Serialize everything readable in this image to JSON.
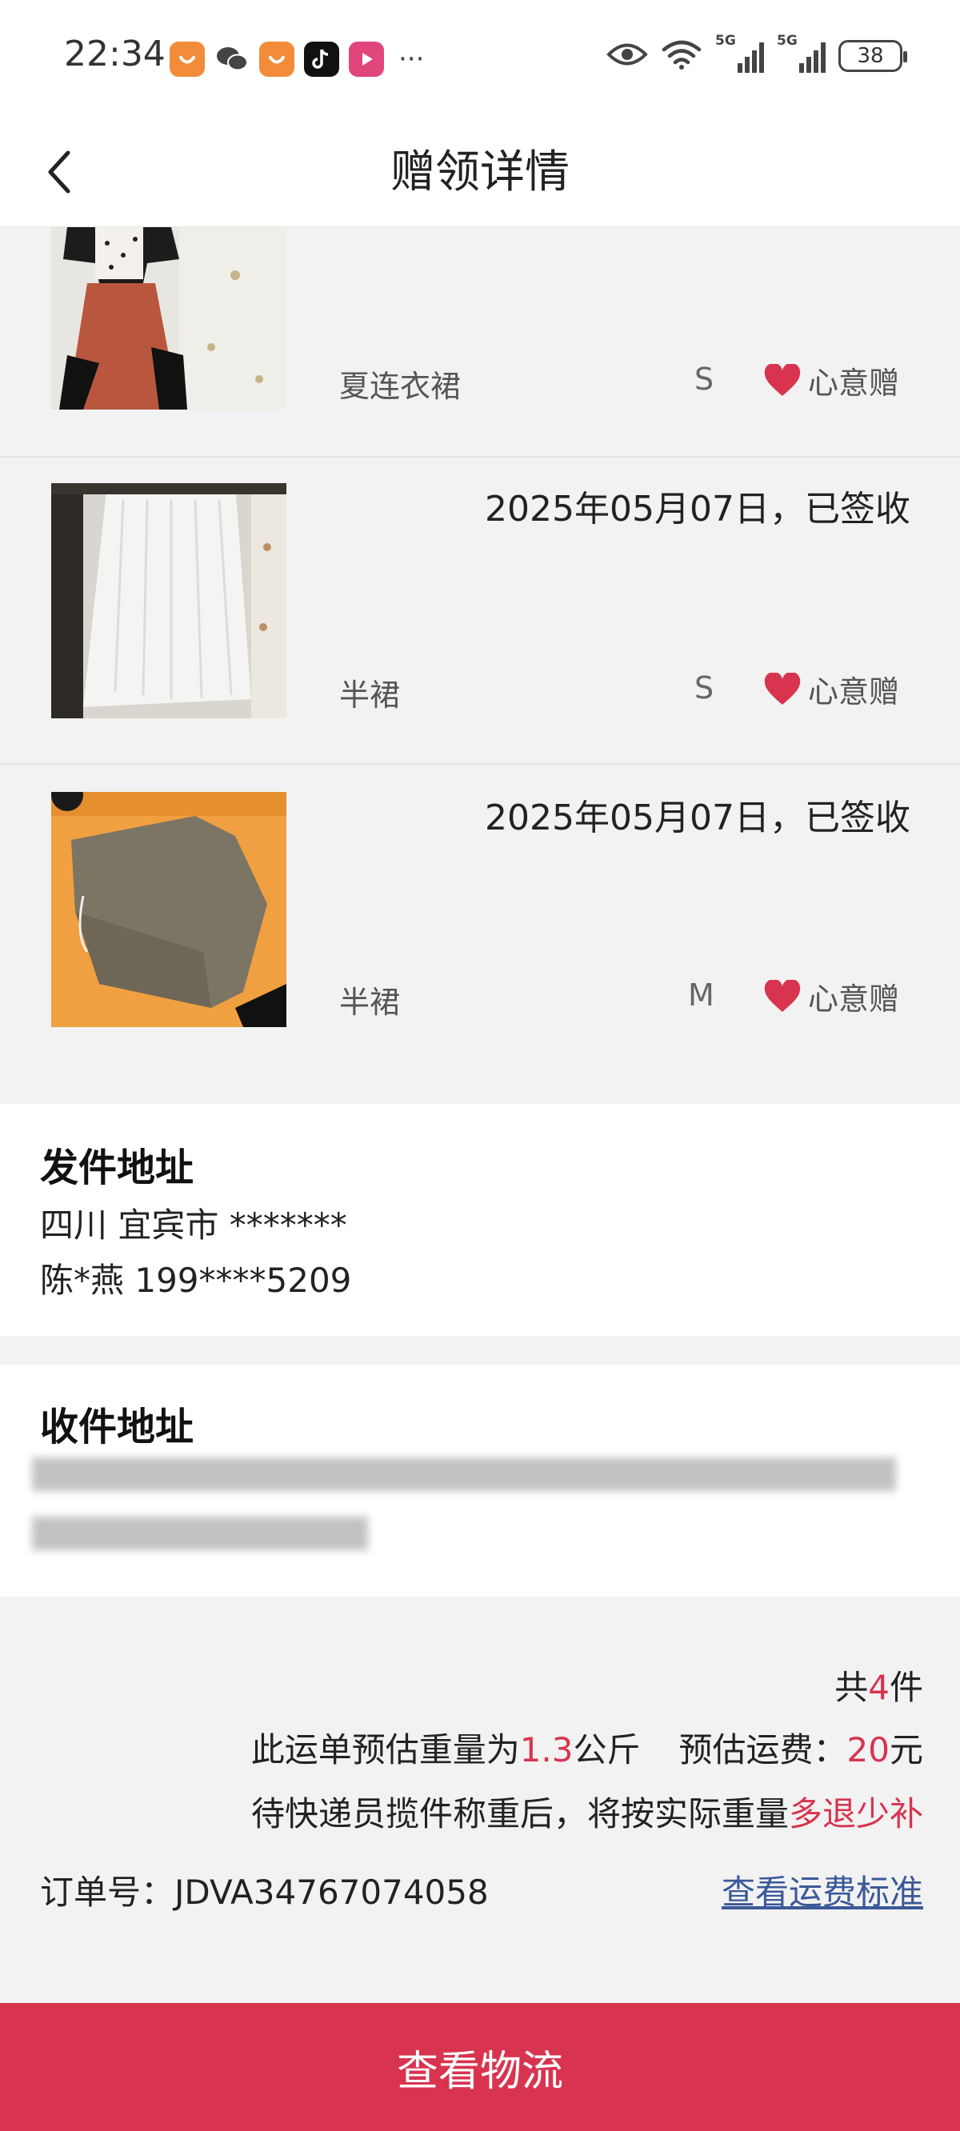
{
  "status_bar": {
    "time": "22:34",
    "apps": [
      "taobao-icon",
      "wechat-icon",
      "taobao-icon",
      "tiktok-icon",
      "video-icon"
    ],
    "more": "···",
    "signal1_label": "5G",
    "signal2_label": "5G",
    "battery": "38"
  },
  "header": {
    "title": "赠领详情"
  },
  "items": [
    {
      "date": "",
      "name": "夏连衣裙",
      "size": "S",
      "tag": "心意赠"
    },
    {
      "date": "2025年05月07日，已签收",
      "name": "半裙",
      "size": "S",
      "tag": "心意赠"
    },
    {
      "date": "2025年05月07日，已签收",
      "name": "半裙",
      "size": "M",
      "tag": "心意赠"
    }
  ],
  "sender": {
    "title": "发件地址",
    "address": "四川 宜宾市 *******",
    "contact": "陈*燕 199****5209"
  },
  "receiver": {
    "title": "收件地址"
  },
  "summary": {
    "total_prefix": "共",
    "total_count": "4",
    "total_suffix": "件",
    "weight_prefix": "此运单预估重量为",
    "weight_value": "1.3",
    "weight_unit": "公斤",
    "fee_label": "预估运费：",
    "fee_value": "20",
    "fee_unit": "元",
    "note_prefix": "待快递员揽件称重后，将按实际重量",
    "note_accent": "多退少补",
    "order_label": "订单号：",
    "order_number": "JDVA34767074058",
    "fee_link": "查看运费标准"
  },
  "bottom_button": "查看物流",
  "colors": {
    "accent": "#d8344f",
    "link": "#3b5998"
  }
}
